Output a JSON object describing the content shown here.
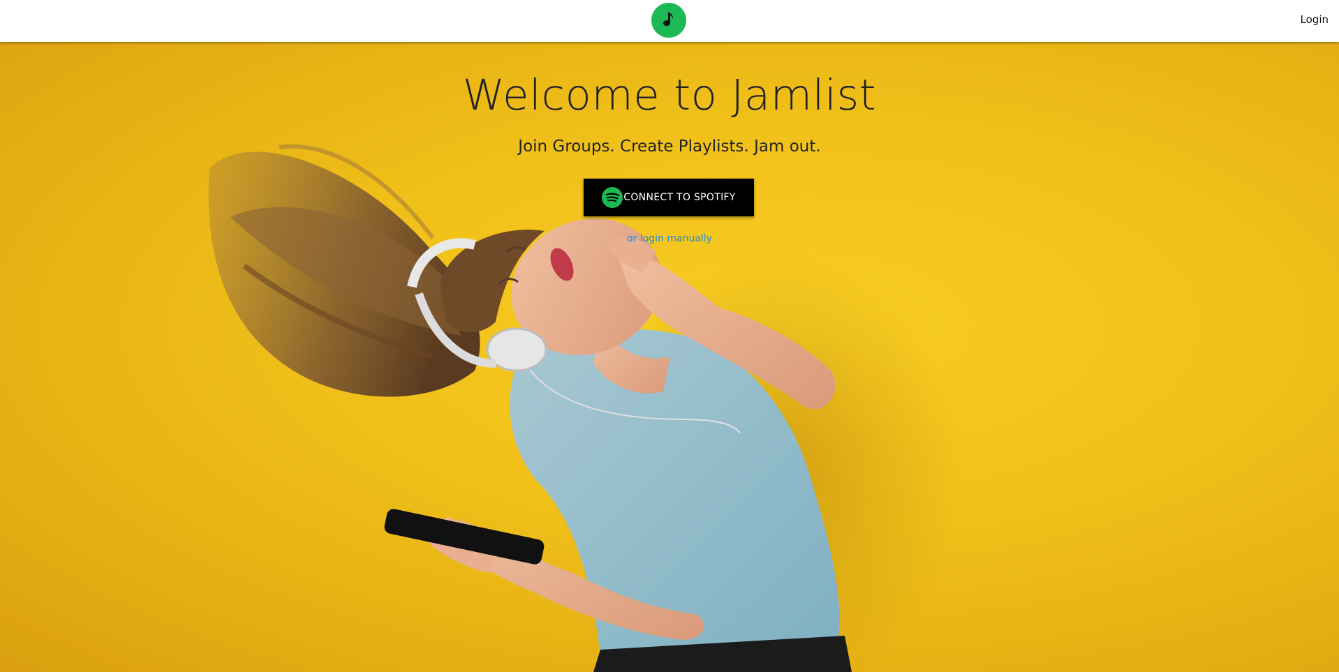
{
  "navbar": {
    "logo_icon": "music-note-icon",
    "login_label": "Login"
  },
  "hero": {
    "title": "Welcome to Jamlist",
    "subtitle": "Join Groups. Create Playlists. Jam out.",
    "connect_button_label": "CONNECT TO SPOTIFY",
    "connect_button_icon": "spotify-icon",
    "manual_login_link": "or login manually",
    "background_image": "woman-with-headphones-dancing-photo"
  },
  "colors": {
    "brand_green": "#1db954",
    "background_yellow": "#f2c318",
    "link_blue": "#1e88e5",
    "button_black": "#000000"
  }
}
